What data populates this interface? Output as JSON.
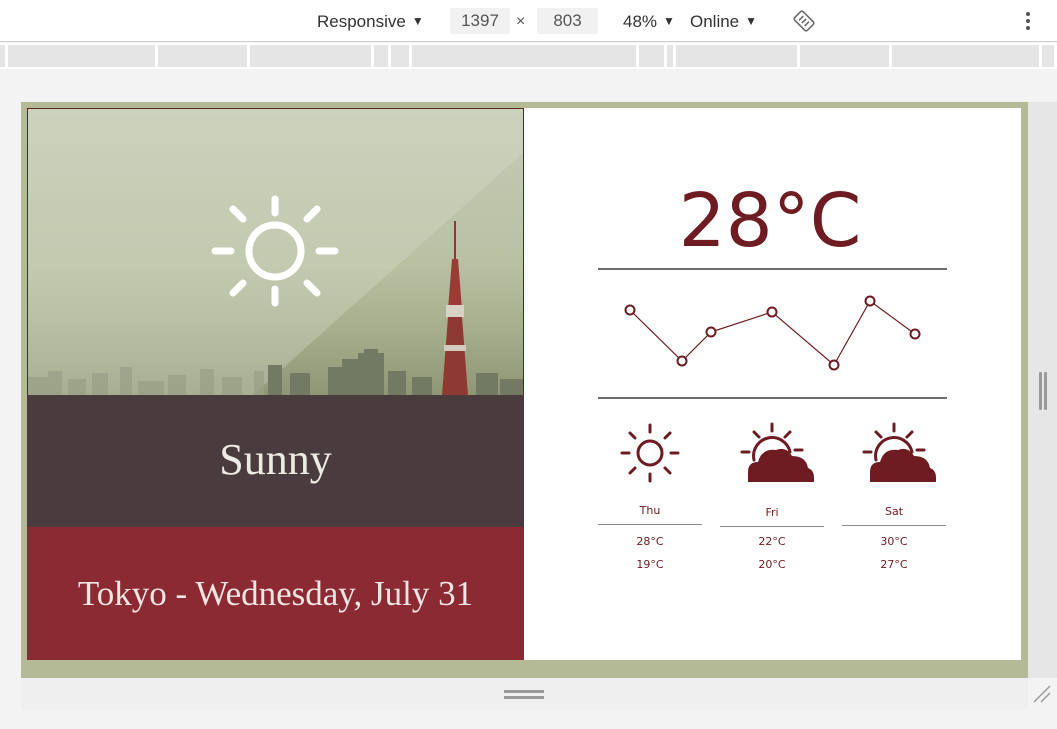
{
  "devtools": {
    "device_mode": "Responsive",
    "width": "1397",
    "height": "803",
    "times": "×",
    "zoom": "48%",
    "network": "Online",
    "icons": {
      "dropdown": "triangle-down-icon",
      "rotate": "rotate-icon",
      "menu": "more-vert-icon"
    }
  },
  "weather": {
    "condition": "Sunny",
    "location_date": "Tokyo - Wednesday, July 31",
    "current_temp": "28°C",
    "main_icon": "sun-icon",
    "trend_points": [
      10,
      61,
      32,
      12,
      65,
      1,
      34
    ],
    "forecast": [
      {
        "day": "Thu",
        "high": "28°C",
        "low": "19°C",
        "icon": "sun-icon"
      },
      {
        "day": "Fri",
        "high": "22°C",
        "low": "20°C",
        "icon": "partly-cloudy-icon"
      },
      {
        "day": "Sat",
        "high": "30°C",
        "low": "27°C",
        "icon": "partly-cloudy-icon"
      }
    ]
  },
  "colors": {
    "accent": "#6e1b22",
    "condition_band": "#4a3c3e",
    "location_band": "#8b2a32",
    "frame": "#b4ba96"
  }
}
